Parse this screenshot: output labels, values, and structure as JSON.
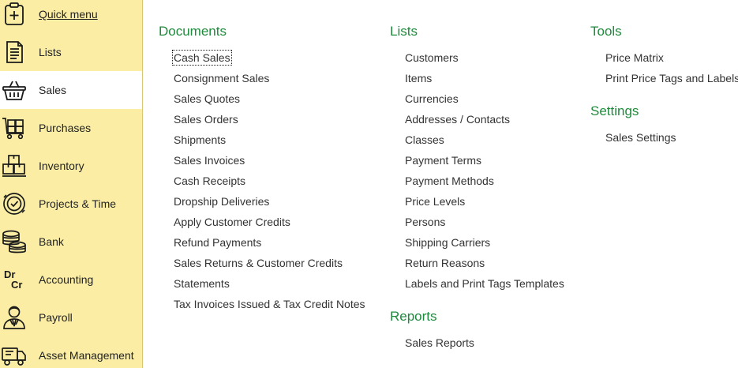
{
  "sidebar": {
    "items": [
      {
        "label": "Quick menu",
        "icon": "quick-menu-icon",
        "active": false
      },
      {
        "label": "Lists",
        "icon": "document-list-icon",
        "active": false
      },
      {
        "label": "Sales",
        "icon": "shopping-basket-icon",
        "active": true
      },
      {
        "label": "Purchases",
        "icon": "shopping-cart-boxes-icon",
        "active": false
      },
      {
        "label": "Inventory",
        "icon": "boxes-icon",
        "active": false
      },
      {
        "label": "Projects & Time",
        "icon": "clock-check-icon",
        "active": false
      },
      {
        "label": "Bank",
        "icon": "coins-stack-icon",
        "active": false
      },
      {
        "label": "Accounting",
        "icon": "dr-cr-icon",
        "active": false
      },
      {
        "label": "Payroll",
        "icon": "person-tie-icon",
        "active": false
      },
      {
        "label": "Asset Management",
        "icon": "truck-icon",
        "active": false
      }
    ],
    "dr_text": "Dr",
    "cr_text": "Cr"
  },
  "documents": {
    "title": "Documents",
    "links": [
      "Cash Sales",
      "Consignment Sales",
      "Sales Quotes",
      "Sales Orders",
      "Shipments",
      "Sales Invoices",
      "Cash Receipts",
      "Dropship Deliveries",
      "Apply Customer Credits",
      "Refund Payments",
      "Sales Returns & Customer Credits",
      "Statements",
      "Tax Invoices Issued & Tax Credit Notes"
    ]
  },
  "lists": {
    "title": "Lists",
    "links": [
      "Customers",
      "Items",
      "Currencies",
      "Addresses / Contacts",
      "Classes",
      "Payment Terms",
      "Payment Methods",
      "Price Levels",
      "Persons",
      "Shipping Carriers",
      "Return Reasons",
      "Labels and Print Tags Templates"
    ]
  },
  "reports": {
    "title": "Reports",
    "links": [
      "Sales Reports"
    ]
  },
  "tools": {
    "title": "Tools",
    "links": [
      "Price Matrix",
      "Print Price Tags and Labels"
    ]
  },
  "settings": {
    "title": "Settings",
    "links": [
      "Sales Settings"
    ]
  },
  "colors": {
    "sidebar_bg": "#fbeea4",
    "section_title": "#1e8b3c",
    "link_text": "#333333"
  }
}
